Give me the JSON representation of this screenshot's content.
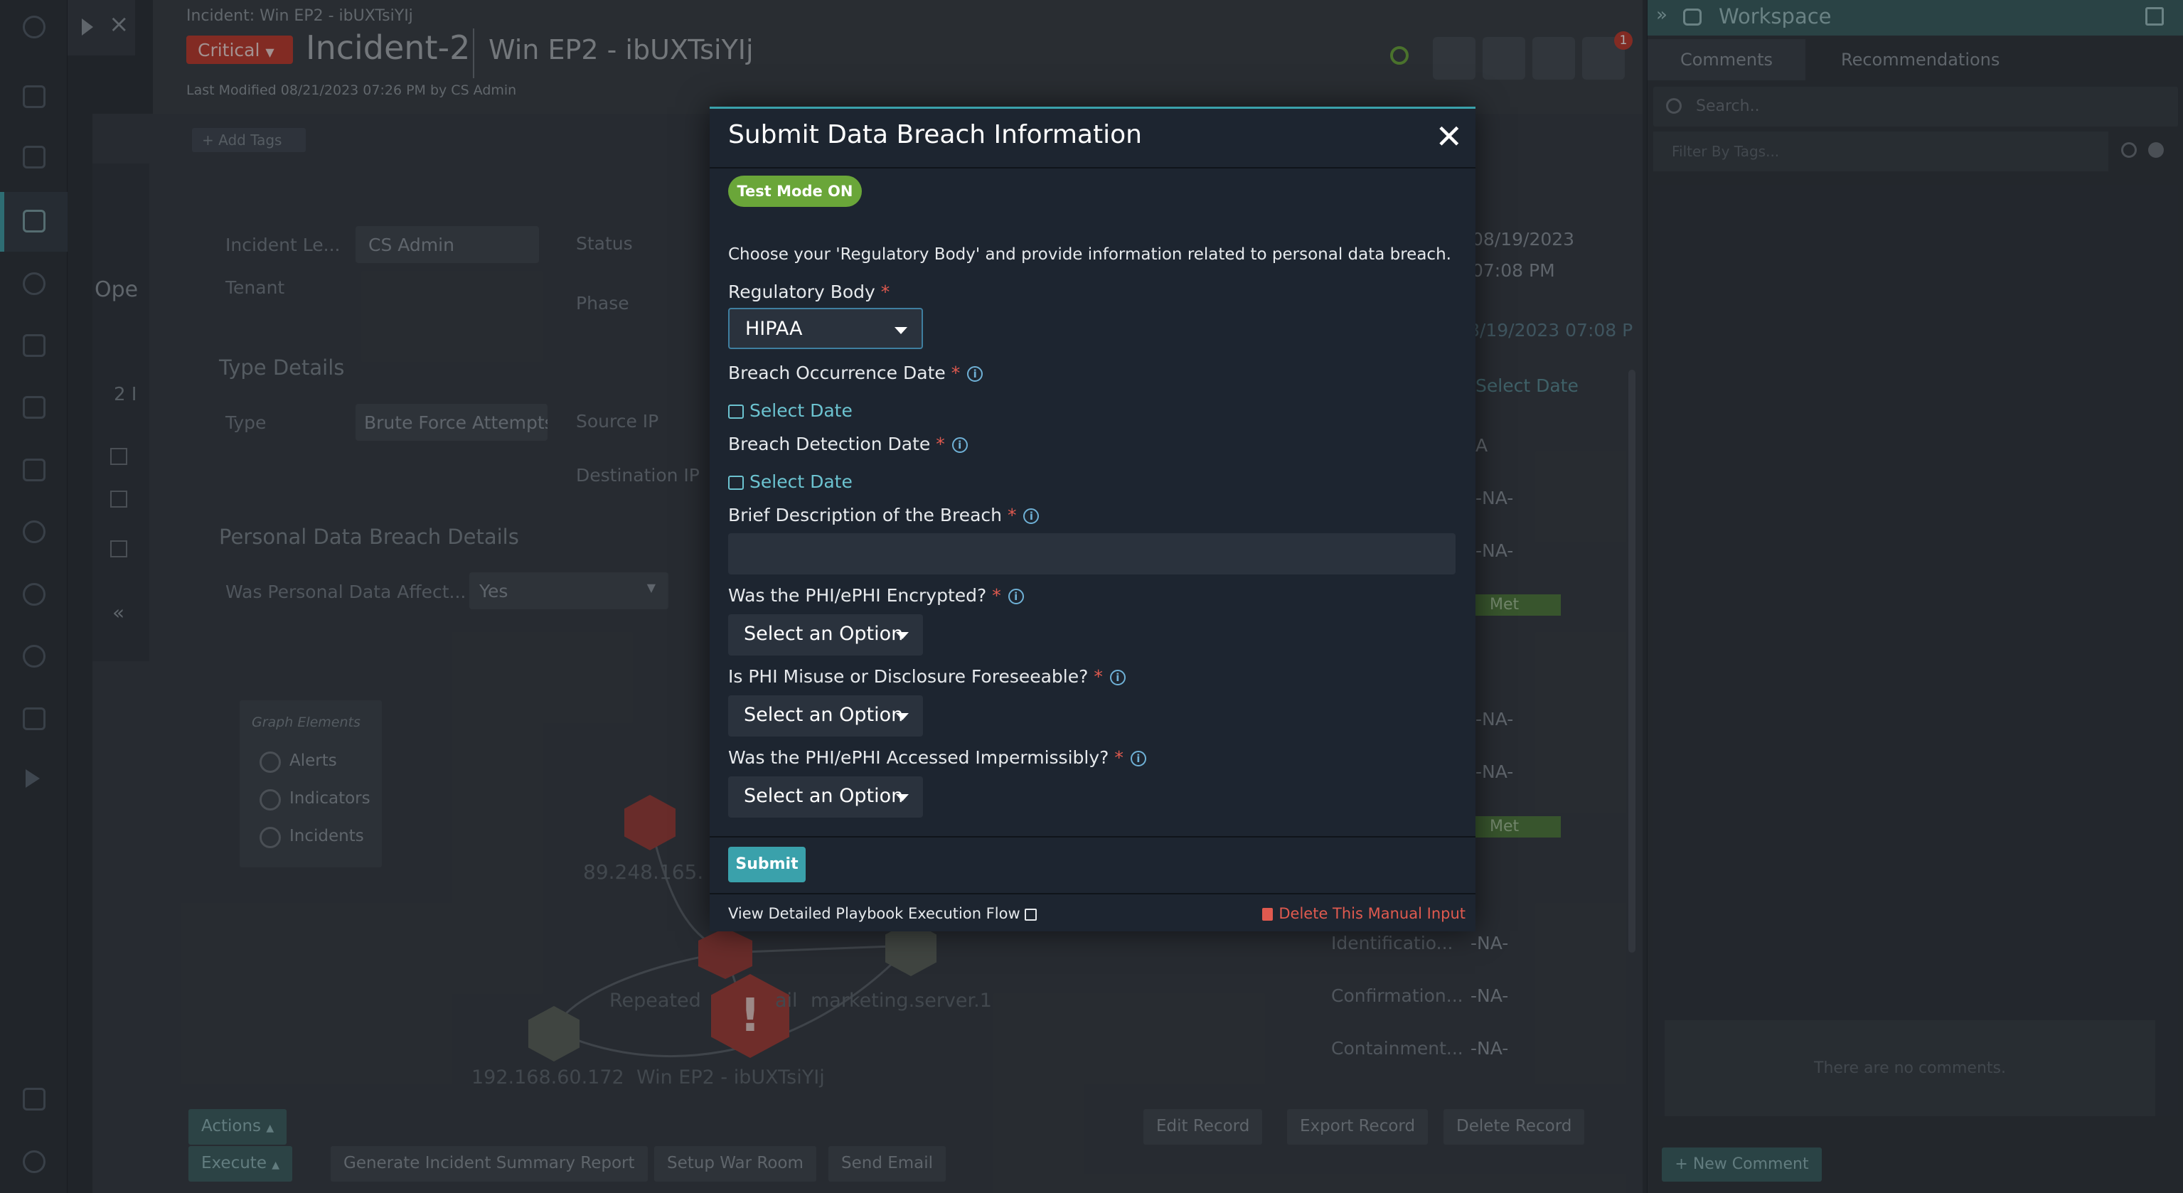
{
  "header": {
    "breadcrumb": "Incident: Win EP2 - ibUXTsiYIj",
    "severity": "Critical",
    "incident_id": "Incident-2",
    "incident_name": "Win EP2 - ibUXTsiYIj",
    "last_modified": "Last Modified 08/21/2023 07:26 PM by CS Admin",
    "add_tags": "+ Add Tags",
    "notification_count": "1"
  },
  "main": {
    "tab_partial": "Ope",
    "count_partial": "2 I",
    "incident_lead_label": "Incident Le...",
    "incident_lead_value": "CS Admin",
    "tenant_label": "Tenant",
    "status_label": "Status",
    "phase_label": "Phase",
    "type_details_heading": "Type Details",
    "type_label": "Type",
    "type_value": "Brute Force Attempts",
    "source_ip_label": "Source IP",
    "destination_ip_label": "Destination IP",
    "breach_heading": "Personal Data Breach Details",
    "personal_data_label": "Was Personal Data Affect...",
    "personal_data_value": "Yes",
    "graph_elements_title": "Graph Elements",
    "graph_alerts": "Alerts",
    "graph_indicators": "Indicators",
    "graph_incidents": "Incidents",
    "node_ip1": "89.248.165.",
    "node_ip2": "192.168.60.172",
    "node_repeated": "Repeated",
    "node_mail": "ail",
    "node_marketing": "marketing.server.1",
    "node_win": "Win EP2 - ibUXTsiYIj",
    "right_date1": "08/19/2023",
    "right_time1": "07:08 PM",
    "right_date2": "8/19/2023 07:08 P",
    "right_select_date": "Select Date",
    "right_a": "A",
    "na": "-NA-",
    "met": "Met",
    "identification_label": "Identificatio...",
    "confirmation_label": "Confirmation...",
    "containment_label": "Containment..."
  },
  "bottom": {
    "actions": "Actions",
    "execute": "Execute",
    "generate_report": "Generate Incident Summary Report",
    "setup_war_room": "Setup War Room",
    "send_email": "Send Email",
    "edit_record": "Edit Record",
    "export_record": "Export Record",
    "delete_record": "Delete Record"
  },
  "workspace": {
    "title": "Workspace",
    "tab_comments": "Comments",
    "tab_recommendations": "Recommendations",
    "search_placeholder": "Search..",
    "filter_placeholder": "Filter By Tags...",
    "empty": "There are no comments.",
    "new_comment": "+ New Comment"
  },
  "modal": {
    "title": "Submit Data Breach Information",
    "close": "✕",
    "test_mode": "Test Mode ON",
    "instructions": "Choose your 'Regulatory Body' and provide information related to personal data breach.",
    "regulatory_body_label": "Regulatory Body",
    "regulatory_body_value": "HIPAA",
    "occurrence_label": "Breach Occurrence Date",
    "detection_label": "Breach Detection Date",
    "select_date": "Select Date",
    "description_label": "Brief Description of the Breach",
    "encrypted_label": "Was the PHI/ePHI Encrypted?",
    "foreseeable_label": "Is PHI Misuse or Disclosure Foreseeable?",
    "accessed_label": "Was the PHI/ePHI Accessed Impermissibly?",
    "select_option": "Select an Option",
    "required_mark": "*",
    "info_mark": "i",
    "submit": "Submit",
    "view_flow": "View Detailed Playbook Execution Flow",
    "delete_input": "Delete This Manual Input"
  },
  "colors": {
    "accent": "#3aa1ab",
    "critical": "#c0392b",
    "test_mode": "#6aa639",
    "danger": "#e05a4f",
    "link": "#6cc3d0"
  }
}
